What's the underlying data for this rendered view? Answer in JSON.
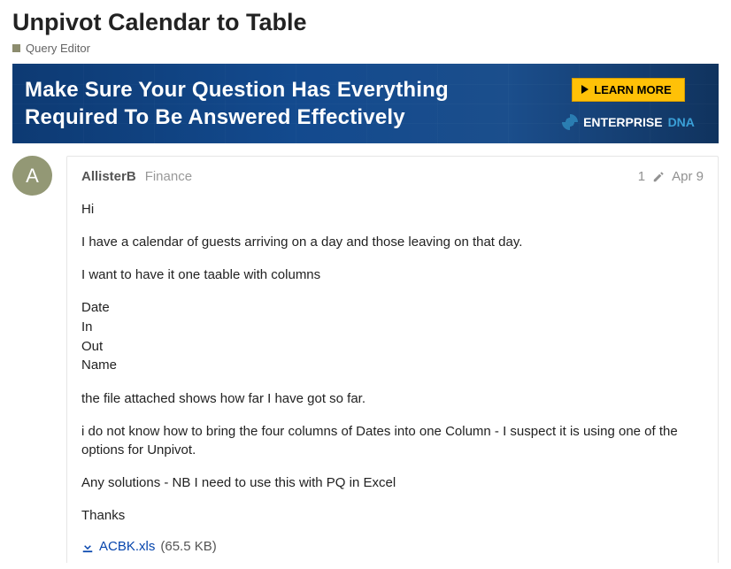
{
  "title": "Unpivot Calendar to Table",
  "category": "Query Editor",
  "banner": {
    "headline": "Make Sure Your Question Has Everything Required To Be Answered Effectively",
    "cta": "LEARN MORE",
    "brand_left": "ENTERPRISE",
    "brand_right": "DNA"
  },
  "post": {
    "avatar_letter": "A",
    "author": "AllisterB",
    "author_group": "Finance",
    "edit_count": "1",
    "date": "Apr 9",
    "body": {
      "p1": "Hi",
      "p2": "I have a calendar of guests arriving on a day and those leaving on that day.",
      "p3": "I want to have it one taable with columns",
      "c1": "Date",
      "c2": "In",
      "c3": "Out",
      "c4": "Name",
      "p4": "the file attached shows how far I have got so far.",
      "p5": "i do not know how to bring the four columns of Dates into one Column - I suspect it is using one of the options for Unpivot.",
      "p6": "Any solutions - NB I need to use this with PQ in Excel",
      "p7": "Thanks"
    },
    "attachment": {
      "name": "ACBK.xls",
      "size": "(65.5 KB)"
    }
  }
}
